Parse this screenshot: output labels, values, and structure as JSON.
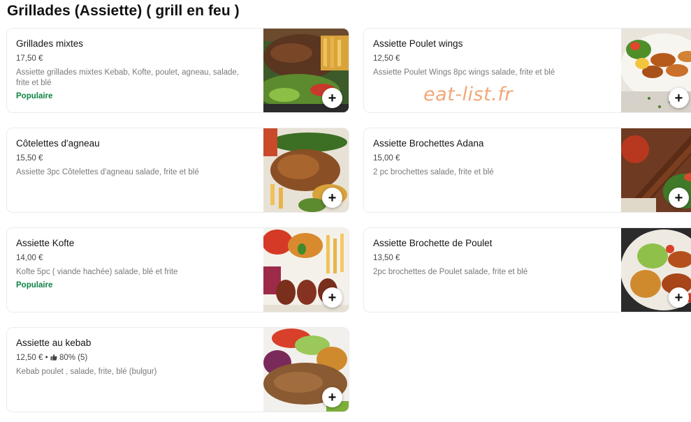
{
  "section": {
    "title": "Grillades (Assiette) ( grill en feu )"
  },
  "watermark": "eat-list.fr",
  "items": [
    {
      "name": "Grillades mixtes",
      "price": "17,50 €",
      "description": "Assiette grillades mixtes Kebab, Kofte, poulet, agneau, salade, frite et blé",
      "badge": "Populaire",
      "image": "mixed-grill-plate"
    },
    {
      "name": "Assiette Poulet wings",
      "price": "12,50 €",
      "description": "Assiette Poulet Wings 8pc wings salade, frite et blé",
      "badge": "",
      "image": "chicken-wings-plate"
    },
    {
      "name": "Côtelettes d'agneau",
      "price": "15,50 €",
      "description": "Assiette 3pc Côtelettes d'agneau salade, frite et blé",
      "badge": "",
      "image": "lamb-chops-plate"
    },
    {
      "name": "Assiette Brochettes Adana",
      "price": "15,00 €",
      "description": "2 pc brochettes salade, frite et blé",
      "badge": "",
      "image": "adana-skewers-plate"
    },
    {
      "name": "Assiette Kofte",
      "price": "14,00 €",
      "description": "Kofte 5pc ( viande hachée) salade, blé et frite",
      "badge": "Populaire",
      "image": "kofte-plate"
    },
    {
      "name": "Assiette Brochette de Poulet",
      "price": "13,50 €",
      "description": "2pc brochettes de Poulet salade, frite et blé",
      "badge": "",
      "image": "chicken-skewers-plate"
    },
    {
      "name": "Assiette au kebab",
      "price": "12,50 €",
      "price_separator": " • ",
      "rating": "80% (5)",
      "description": "Kebab poulet , salade, frite, blé (bulgur)",
      "badge": "",
      "image": "kebab-plate"
    }
  ],
  "add_button_label": "+",
  "colors": {
    "popular": "#0e8345",
    "watermark": "#f2a77a"
  }
}
